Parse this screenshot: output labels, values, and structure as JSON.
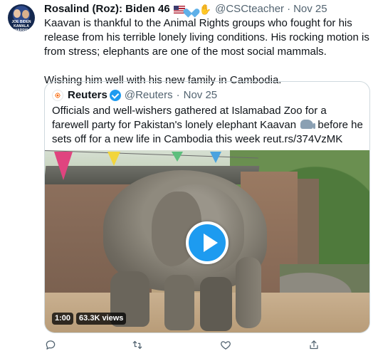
{
  "tweet": {
    "author_name": "Rosalind (Roz): Biden 46",
    "author_handle": "@CSCteacher",
    "separator": "·",
    "date": "Nov 25",
    "avatar_caption": "JOE BIDEN KAMALA HARRIS",
    "paragraph_1": "Kaavan is thankful to the Animal Rights groups who fought for his release from his terrible lonely living conditions. His rocking motion is from stress; elephants are one of the most social mammals.",
    "paragraph_2": "Wishing him well with his new family in Cambodia."
  },
  "quoted_tweet": {
    "author_name": "Reuters",
    "author_handle": "@Reuters",
    "separator": "·",
    "date": "Nov 25",
    "text_before_emoji": "Officials and well-wishers gathered at Islamabad Zoo for a farewell party for Pakistan's lonely elephant Kaavan",
    "text_after_emoji": " before he sets off for a new life in Cambodia this week reut.rs/374VzMK"
  },
  "video": {
    "duration": "1:00",
    "views": "63.3K views"
  },
  "actions": {
    "icons": [
      "reply-icon",
      "retweet-icon",
      "like-icon",
      "share-icon"
    ]
  },
  "colors": {
    "accent": "#1d9bf0",
    "secondary_text": "#536471",
    "border": "#cfd9de"
  }
}
